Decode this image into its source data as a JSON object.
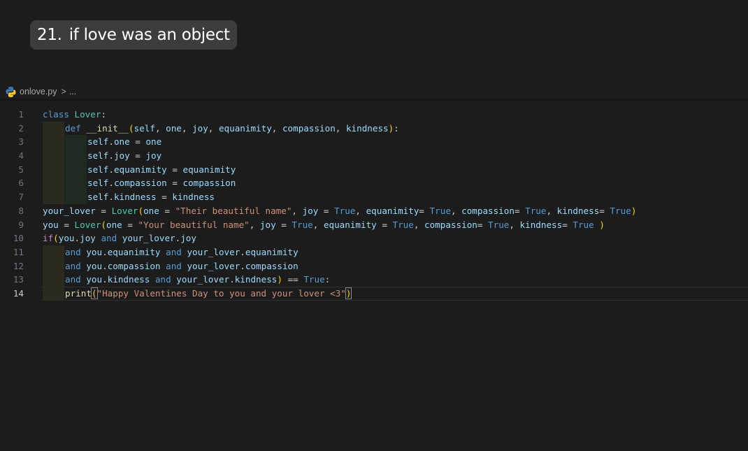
{
  "title": {
    "number": "21.",
    "text": "if love was an object"
  },
  "breadcrumb": {
    "file_icon": "python-icon",
    "filename": "onlove.py",
    "separator": ">",
    "trail": "..."
  },
  "editor": {
    "current_line": 14,
    "line_numbers": [
      "1",
      "2",
      "3",
      "4",
      "5",
      "6",
      "7",
      "8",
      "9",
      "10",
      "11",
      "12",
      "13",
      "14"
    ],
    "lines": [
      [
        {
          "t": "class",
          "c": "kw"
        },
        {
          "t": " "
        },
        {
          "t": "Lover",
          "c": "cls"
        },
        {
          "t": ":"
        }
      ],
      [
        {
          "t": "def",
          "c": "kw"
        },
        {
          "t": " "
        },
        {
          "t": "__init__",
          "c": "fn"
        },
        {
          "t": "(",
          "c": "par"
        },
        {
          "t": "self",
          "c": "var"
        },
        {
          "t": ", "
        },
        {
          "t": "one",
          "c": "var"
        },
        {
          "t": ", "
        },
        {
          "t": "joy",
          "c": "var"
        },
        {
          "t": ", "
        },
        {
          "t": "equanimity",
          "c": "var"
        },
        {
          "t": ", "
        },
        {
          "t": "compassion",
          "c": "var"
        },
        {
          "t": ", "
        },
        {
          "t": "kindness",
          "c": "var"
        },
        {
          "t": ")",
          "c": "par"
        },
        {
          "t": ":"
        }
      ],
      [
        {
          "t": "self",
          "c": "var"
        },
        {
          "t": "."
        },
        {
          "t": "one",
          "c": "var"
        },
        {
          "t": " = ",
          "c": "op"
        },
        {
          "t": "one",
          "c": "var"
        }
      ],
      [
        {
          "t": "self",
          "c": "var"
        },
        {
          "t": "."
        },
        {
          "t": "joy",
          "c": "var"
        },
        {
          "t": " = ",
          "c": "op"
        },
        {
          "t": "joy",
          "c": "var"
        }
      ],
      [
        {
          "t": "self",
          "c": "var"
        },
        {
          "t": "."
        },
        {
          "t": "equanimity",
          "c": "var"
        },
        {
          "t": " = ",
          "c": "op"
        },
        {
          "t": "equanimity",
          "c": "var"
        }
      ],
      [
        {
          "t": "self",
          "c": "var"
        },
        {
          "t": "."
        },
        {
          "t": "compassion",
          "c": "var"
        },
        {
          "t": " = ",
          "c": "op"
        },
        {
          "t": "compassion",
          "c": "var"
        }
      ],
      [
        {
          "t": "self",
          "c": "var"
        },
        {
          "t": "."
        },
        {
          "t": "kindness",
          "c": "var"
        },
        {
          "t": " = ",
          "c": "op"
        },
        {
          "t": "kindness",
          "c": "var"
        }
      ],
      [
        {
          "t": "your_lover",
          "c": "var"
        },
        {
          "t": " = ",
          "c": "op"
        },
        {
          "t": "Lover",
          "c": "cls"
        },
        {
          "t": "(",
          "c": "par"
        },
        {
          "t": "one",
          "c": "var"
        },
        {
          "t": " = ",
          "c": "op"
        },
        {
          "t": "\"Their beautiful name\"",
          "c": "str"
        },
        {
          "t": ", "
        },
        {
          "t": "joy",
          "c": "var"
        },
        {
          "t": " = ",
          "c": "op"
        },
        {
          "t": "True",
          "c": "const"
        },
        {
          "t": ", "
        },
        {
          "t": "equanimity",
          "c": "var"
        },
        {
          "t": "= ",
          "c": "op"
        },
        {
          "t": "True",
          "c": "const"
        },
        {
          "t": ", "
        },
        {
          "t": "compassion",
          "c": "var"
        },
        {
          "t": "= ",
          "c": "op"
        },
        {
          "t": "True",
          "c": "const"
        },
        {
          "t": ", "
        },
        {
          "t": "kindness",
          "c": "var"
        },
        {
          "t": "= ",
          "c": "op"
        },
        {
          "t": "True",
          "c": "const"
        },
        {
          "t": ")",
          "c": "par"
        }
      ],
      [
        {
          "t": "you",
          "c": "var"
        },
        {
          "t": " = ",
          "c": "op"
        },
        {
          "t": "Lover",
          "c": "cls"
        },
        {
          "t": "(",
          "c": "par"
        },
        {
          "t": "one",
          "c": "var"
        },
        {
          "t": " = ",
          "c": "op"
        },
        {
          "t": "\"Your beautiful name\"",
          "c": "str"
        },
        {
          "t": ", "
        },
        {
          "t": "joy",
          "c": "var"
        },
        {
          "t": " = ",
          "c": "op"
        },
        {
          "t": "True",
          "c": "const"
        },
        {
          "t": ", "
        },
        {
          "t": "equanimity",
          "c": "var"
        },
        {
          "t": " = ",
          "c": "op"
        },
        {
          "t": "True",
          "c": "const"
        },
        {
          "t": ", "
        },
        {
          "t": "compassion",
          "c": "var"
        },
        {
          "t": "= ",
          "c": "op"
        },
        {
          "t": "True",
          "c": "const"
        },
        {
          "t": ", "
        },
        {
          "t": "kindness",
          "c": "var"
        },
        {
          "t": "= ",
          "c": "op"
        },
        {
          "t": "True",
          "c": "const"
        },
        {
          "t": " "
        },
        {
          "t": ")",
          "c": "par"
        }
      ],
      [
        {
          "t": "if",
          "c": "kw-ctrl"
        },
        {
          "t": "(",
          "c": "par"
        },
        {
          "t": "you",
          "c": "var"
        },
        {
          "t": "."
        },
        {
          "t": "joy",
          "c": "var"
        },
        {
          "t": " "
        },
        {
          "t": "and",
          "c": "kw"
        },
        {
          "t": " "
        },
        {
          "t": "your_lover",
          "c": "var"
        },
        {
          "t": "."
        },
        {
          "t": "joy",
          "c": "var"
        }
      ],
      [
        {
          "t": "and",
          "c": "kw"
        },
        {
          "t": " "
        },
        {
          "t": "you",
          "c": "var"
        },
        {
          "t": "."
        },
        {
          "t": "equanimity",
          "c": "var"
        },
        {
          "t": " "
        },
        {
          "t": "and",
          "c": "kw"
        },
        {
          "t": " "
        },
        {
          "t": "your_lover",
          "c": "var"
        },
        {
          "t": "."
        },
        {
          "t": "equanimity",
          "c": "var"
        }
      ],
      [
        {
          "t": "and",
          "c": "kw"
        },
        {
          "t": " "
        },
        {
          "t": "you",
          "c": "var"
        },
        {
          "t": "."
        },
        {
          "t": "compassion",
          "c": "var"
        },
        {
          "t": " "
        },
        {
          "t": "and",
          "c": "kw"
        },
        {
          "t": " "
        },
        {
          "t": "your_lover",
          "c": "var"
        },
        {
          "t": "."
        },
        {
          "t": "compassion",
          "c": "var"
        }
      ],
      [
        {
          "t": "and",
          "c": "kw"
        },
        {
          "t": " "
        },
        {
          "t": "you",
          "c": "var"
        },
        {
          "t": "."
        },
        {
          "t": "kindness",
          "c": "var"
        },
        {
          "t": " "
        },
        {
          "t": "and",
          "c": "kw"
        },
        {
          "t": " "
        },
        {
          "t": "your_lover",
          "c": "var"
        },
        {
          "t": "."
        },
        {
          "t": "kindness",
          "c": "var"
        },
        {
          "t": ")",
          "c": "par"
        },
        {
          "t": " == ",
          "c": "op"
        },
        {
          "t": "True",
          "c": "const"
        },
        {
          "t": ":"
        }
      ],
      [
        {
          "t": "print",
          "c": "fn"
        },
        {
          "t": "(",
          "c": "par bm"
        },
        {
          "t": "\"Happy Valentines Day to you and your lover <3\"",
          "c": "str"
        },
        {
          "t": ")",
          "c": "par bm"
        }
      ]
    ],
    "indents": [
      0,
      1,
      2,
      2,
      2,
      2,
      2,
      0,
      0,
      0,
      1,
      1,
      1,
      1
    ]
  }
}
